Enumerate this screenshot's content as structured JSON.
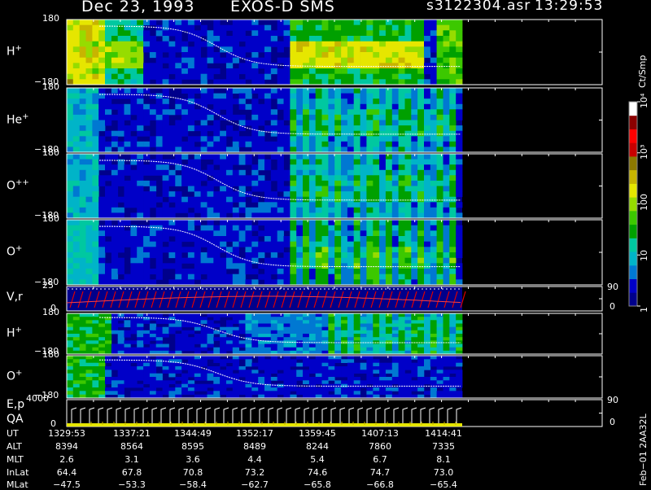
{
  "header": {
    "date": "Dec 23, 1993",
    "instrument": "EXOS-D SMS",
    "file": "s3122304.asr",
    "time": "13:29:53"
  },
  "colorbar": {
    "unit": "Ct/Smp",
    "ticks": [
      {
        "label": "1",
        "value": 1
      },
      {
        "label": "10",
        "value": 10
      },
      {
        "label": "100",
        "value": 100
      },
      {
        "label": "10³",
        "value": 1000
      },
      {
        "label": "10⁴",
        "value": 10000
      }
    ],
    "colors": [
      "#00008b",
      "#0000c8",
      "#0078d2",
      "#00b4c8",
      "#00c8a0",
      "#00a000",
      "#3cc800",
      "#96dc00",
      "#e6e600",
      "#c8b400",
      "#8c7800",
      "#c80000",
      "#ff0000",
      "#8b0000",
      "#ffffff"
    ]
  },
  "panels": [
    {
      "label_main": "H",
      "label_sup": "+",
      "y_top": "180",
      "y_bottom": "−180"
    },
    {
      "label_main": "He",
      "label_sup": "+",
      "y_top": "180",
      "y_bottom": "−180"
    },
    {
      "label_main": "O",
      "label_sup": "++",
      "y_top": "180",
      "y_bottom": "−180"
    },
    {
      "label_main": "O",
      "label_sup": "+",
      "y_top": "180",
      "y_bottom": "−180"
    },
    {
      "label_main": "V,r",
      "label_sup": "",
      "y_top": "25",
      "y_bottom": "0",
      "right_top": "90",
      "right_bottom": "0"
    },
    {
      "label_main": "H",
      "label_sup": "+",
      "y_top": "180",
      "y_bottom": "−180"
    },
    {
      "label_main": "O",
      "label_sup": "+",
      "y_top": "180",
      "y_bottom": "−180"
    },
    {
      "label_main": "E,p",
      "label_sup": "",
      "label_line2": "QA",
      "y_top": "4000",
      "y_bottom": "0",
      "right_top": "90",
      "right_bottom": "0"
    }
  ],
  "table": {
    "row_labels": [
      "UT",
      "ALT",
      "MLT",
      "InLat",
      "MLat"
    ],
    "columns": [
      {
        "UT": "1329:53",
        "ALT": "8394",
        "MLT": "2.6",
        "InLat": "64.4",
        "MLat": "−47.5"
      },
      {
        "UT": "1337:21",
        "ALT": "8564",
        "MLT": "3.1",
        "InLat": "67.8",
        "MLat": "−53.3"
      },
      {
        "UT": "1344:49",
        "ALT": "8595",
        "MLT": "3.6",
        "InLat": "70.8",
        "MLat": "−58.4"
      },
      {
        "UT": "1352:17",
        "ALT": "8489",
        "MLT": "4.4",
        "InLat": "73.2",
        "MLat": "−62.7"
      },
      {
        "UT": "1359:45",
        "ALT": "8244",
        "MLT": "5.4",
        "InLat": "74.6",
        "MLat": "−65.8"
      },
      {
        "UT": "1407:13",
        "ALT": "7860",
        "MLT": "6.7",
        "InLat": "74.7",
        "MLat": "−66.8"
      },
      {
        "UT": "1414:41",
        "ALT": "7335",
        "MLT": "8.1",
        "InLat": "73.0",
        "MLat": "−65.4"
      }
    ]
  },
  "footer": {
    "code": "Feb−01 2AA32L"
  },
  "chart_data": {
    "type": "heatmap",
    "title": "Dec 23, 1993   EXOS-D SMS",
    "x_ticks": [
      "1329:53",
      "1337:21",
      "1344:49",
      "1352:17",
      "1359:45",
      "1407:13",
      "1414:41"
    ],
    "colorbar_unit": "Ct/Smp",
    "colorbar_scale": "log",
    "colorbar_range": [
      1,
      10000
    ],
    "panels": [
      "H+",
      "He+",
      "O++",
      "O+",
      "V,r",
      "H+",
      "O+",
      "E,p QA"
    ]
  }
}
